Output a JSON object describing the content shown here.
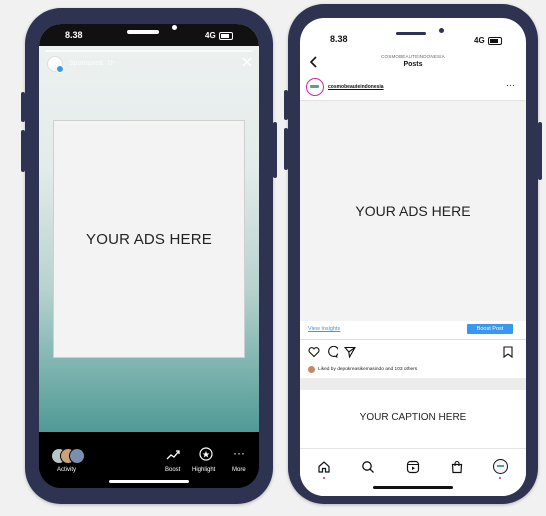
{
  "left_phone": {
    "status": {
      "time": "8.38",
      "signal": "4G"
    },
    "story": {
      "account_name": "Sponsored",
      "time_ago": "1h",
      "ad_placeholder": "YOUR ADS HERE"
    },
    "bottom_bar": {
      "activity_label": "Activity",
      "boost_label": "Boost",
      "highlight_label": "Highlight",
      "more_label": "More"
    },
    "colors": {
      "gradient_top": "#eef2f1",
      "gradient_bottom": "#4f9a95"
    }
  },
  "right_phone": {
    "status": {
      "time": "8.38",
      "signal": "4G"
    },
    "header": {
      "account_caps": "COSMOBEAUTEINDONESIA",
      "title": "Posts"
    },
    "post": {
      "account": "cosmobeauteindonesia",
      "ad_placeholder": "YOUR ADS HERE",
      "view_insights": "View Insights",
      "boost_post": "Boost Post",
      "liked_by": "Liked by depokreasikemasindo and 103 others",
      "caption_placeholder": "YOUR CAPTION HERE"
    },
    "colors": {
      "accent": "#3897f0",
      "frame": "#2e3352"
    }
  }
}
